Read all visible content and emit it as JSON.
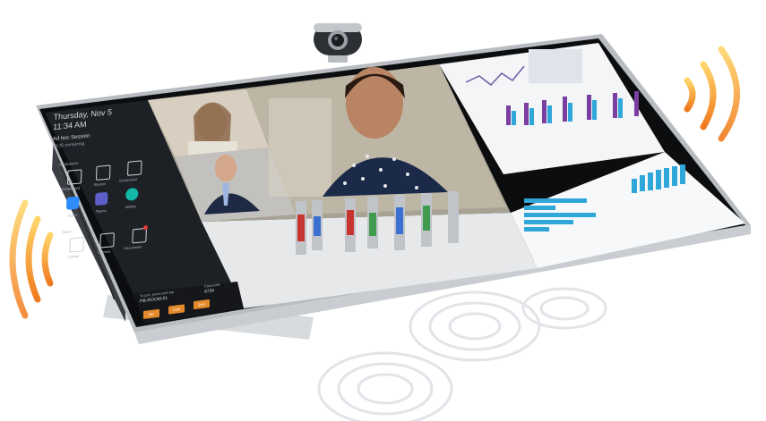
{
  "sidebar": {
    "day": "Thursday, Nov 5",
    "time": "11:34 AM",
    "meeting_title": "Ad hoc Session",
    "meeting_sub": "09:26 remaining",
    "section1_label": "Applications",
    "section1_items": [
      "Whiteboard",
      "Record",
      "Screenshot"
    ],
    "section2_items": [
      "Zoom",
      "Teams",
      "Webex"
    ],
    "section3_label": "Share",
    "section3_items": [
      "Laptop",
      "Camera",
      "Documents"
    ],
    "footer_left_label": "To join, press and tap",
    "footer_left_value": "PB-ROOM-01",
    "footer_right_label": "Passcode",
    "footer_right_value": "4736",
    "buttons": [
      "Mic",
      "Cam",
      "End"
    ]
  },
  "colors": {
    "accent_orange": "#e58a2a",
    "sidebar_bg": "#1c1f24",
    "bar_teal": "#2fa7d8",
    "bar_purple": "#7a3fa0"
  },
  "icons": [
    "whiteboard-icon",
    "record-icon",
    "screenshot-icon",
    "zoom-icon",
    "teams-icon",
    "webex-icon",
    "laptop-icon",
    "camera-icon",
    "documents-icon",
    "webcam-icon"
  ]
}
